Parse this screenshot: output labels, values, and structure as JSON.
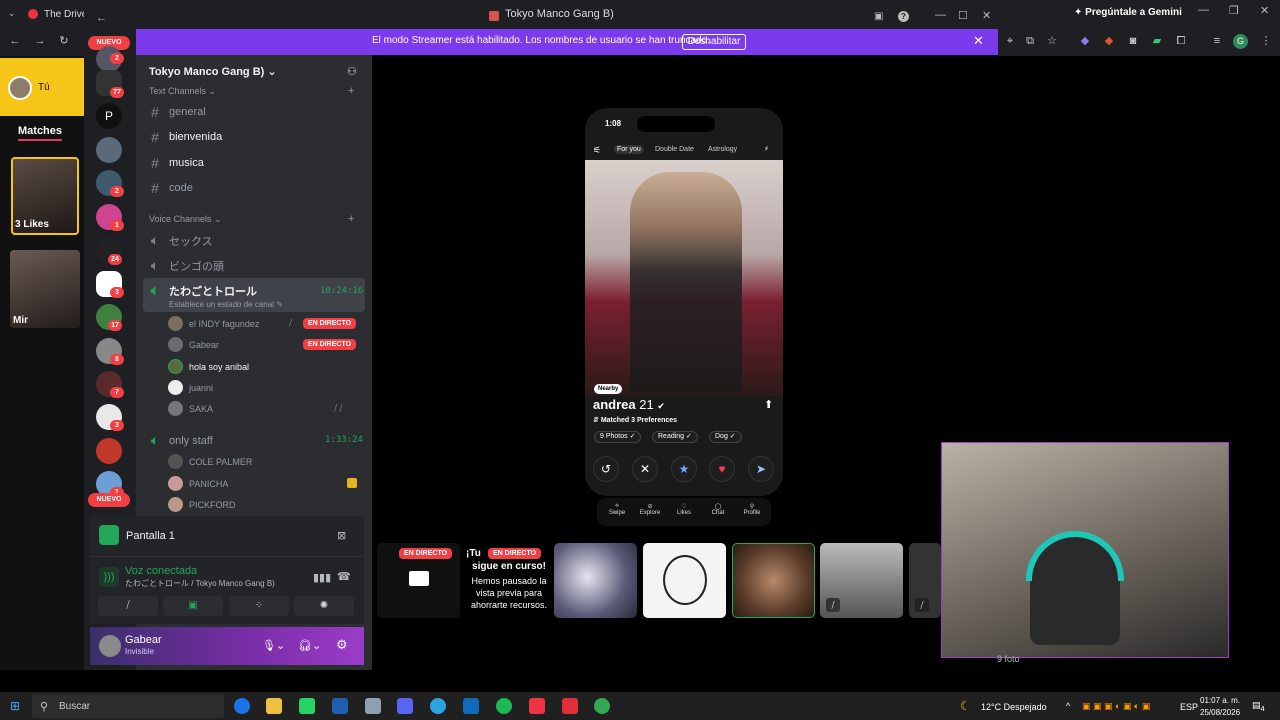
{
  "browser": {
    "tab_title": "The Drive",
    "gemini_label": "Pregúntale a Gemini",
    "profile_initial": "G"
  },
  "tinder": {
    "user_label": "Tú",
    "matches_label": "Matches",
    "likes_label": "3 Likes",
    "match_name": "Mir"
  },
  "discord": {
    "window_title": "Tokyo Manco Gang B)",
    "streamer_banner": "El modo Streamer está habilitado. Los nombres de usuario se han truncado.",
    "streamer_disable": "Deshabilitar",
    "nuevo_label": "NUEVO",
    "server_p": "P",
    "servers_badges": [
      "2",
      "77",
      "2",
      "1",
      "24",
      "3",
      "17",
      "8",
      "7",
      "3",
      "1"
    ],
    "guild_name": "Tokyo Manco Gang B)",
    "text_category": "Text Channels",
    "text_channels": [
      "general",
      "bienvenida",
      "musica",
      "code"
    ],
    "voice_category": "Voice Channels",
    "voice_channels": [
      "セックス",
      "ビンゴの頭"
    ],
    "active_voice": {
      "name": "たわごとトロール",
      "timer": "10:24:16",
      "status": "Establece un estado de canal"
    },
    "members": [
      {
        "name": "el INDY fagundez",
        "live": "EN DIRECTO"
      },
      {
        "name": "Gabear",
        "live": "EN DIRECTO"
      },
      {
        "name": "hola soy anibal",
        "live": ""
      },
      {
        "name": "juanni",
        "live": ""
      },
      {
        "name": "SAKA",
        "live": ""
      }
    ],
    "staff_channel": {
      "name": "only staff",
      "timer": "1:33:24"
    },
    "staff_members": [
      "COLE PALMER",
      "PANICHA",
      "PICKFORD"
    ],
    "screen_panel": {
      "label": "Pantalla 1"
    },
    "voice_panel": {
      "status": "Voz conectada",
      "channel": "たわごとトロール / Tokyo Manco Gang B)"
    },
    "user": {
      "name": "Gabear",
      "status": "Invisible"
    },
    "stream_notice": {
      "live_a": "EN DIRECTO",
      "live_b": "EN DIRECTO",
      "title": "¡Tu transmisión sigue en curso!",
      "title_visible": "¡Tu",
      "title_line2": "sigue en curso!",
      "body": "Hemos pausado la vista previa para ahorrarte recursos."
    }
  },
  "phone": {
    "time": "1:08",
    "tabs": [
      "For you",
      "Double Date",
      "Astrology"
    ],
    "nearby": "Nearby",
    "name": "andrea",
    "age": "21",
    "matched": "Matched 3 Preferences",
    "pills": [
      "9 Photos",
      "Reading",
      "Dog"
    ],
    "nav": [
      "Swipe",
      "Explore",
      "Likes",
      "Chat",
      "Profile"
    ]
  },
  "webcam_caption": "9 foto",
  "taskbar": {
    "search_placeholder": "Buscar",
    "weather_temp": "12°C",
    "weather_desc": "Despejado",
    "lang": "ESP",
    "time": "01:07 a. m.",
    "date": "25/08/2026",
    "notif_count": "4"
  },
  "colors": {
    "discord_accent": "#7c3aed",
    "live_red": "#f23f43",
    "voice_green": "#23a55a",
    "tinder_yellow": "#f5c518"
  }
}
